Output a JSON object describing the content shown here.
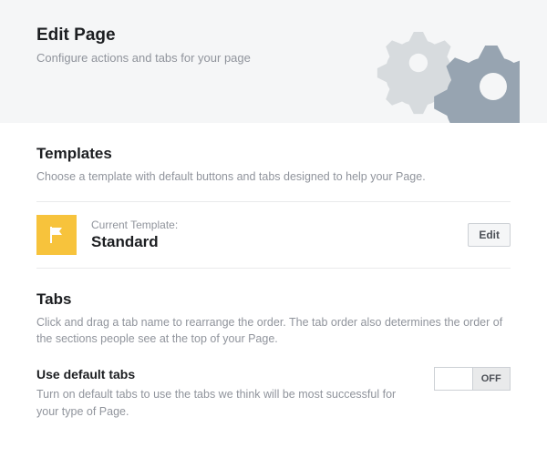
{
  "header": {
    "title": "Edit Page",
    "subtitle": "Configure actions and tabs for your page"
  },
  "templates": {
    "heading": "Templates",
    "desc": "Choose a template with default buttons and tabs designed to help your Page.",
    "current_label": "Current Template:",
    "current_value": "Standard",
    "edit_label": "Edit"
  },
  "tabs": {
    "heading": "Tabs",
    "desc": "Click and drag a tab name to rearrange the order. The tab order also determines the order of the sections people see at the top of your Page.",
    "default_heading": "Use default tabs",
    "default_desc": "Turn on default tabs to use the tabs we think will be most successful for your type of Page.",
    "toggle_on": "",
    "toggle_off": "OFF"
  }
}
